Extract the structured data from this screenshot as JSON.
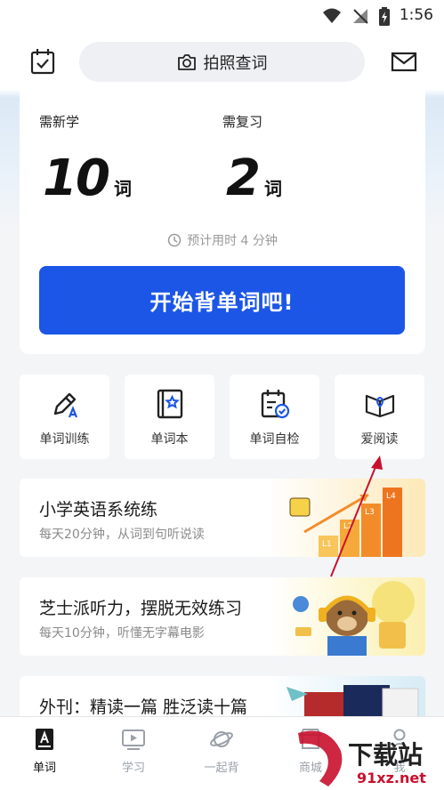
{
  "status_bar": {
    "time": "1:56"
  },
  "header": {
    "search_label": "拍照查词"
  },
  "plan": {
    "new_label": "需新学",
    "new_count": "10",
    "review_label": "需复习",
    "review_count": "2",
    "unit": "词",
    "estimate": "预计用时 4 分钟",
    "start_button": "开始背单词吧!"
  },
  "tools": [
    {
      "label": "单词训练",
      "icon": "pencil-icon"
    },
    {
      "label": "单词本",
      "icon": "star-book-icon"
    },
    {
      "label": "单词自检",
      "icon": "calendar-check-icon"
    },
    {
      "label": "爱阅读",
      "icon": "open-book-icon"
    }
  ],
  "courses": [
    {
      "title": "小学英语系统练",
      "subtitle": "每天20分钟，从词到句听说读",
      "levels": [
        "L1",
        "L2",
        "L3",
        "L4"
      ]
    },
    {
      "title": "芝士派听力，摆脱无效练习",
      "subtitle": "每天10分钟，听懂无字幕电影"
    },
    {
      "title": "外刊：精读一篇 胜泛读十篇"
    }
  ],
  "tabbar": [
    {
      "label": "单词",
      "active": true
    },
    {
      "label": "学习",
      "active": false
    },
    {
      "label": "一起背",
      "active": false
    },
    {
      "label": "商城",
      "active": false
    },
    {
      "label": "我",
      "active": false
    }
  ],
  "watermark": {
    "main": "下载站",
    "site": "91xz.net"
  },
  "colors": {
    "accent": "#1c56e6",
    "icon_blue": "#1c56e6",
    "arrow": "#c8102e"
  }
}
